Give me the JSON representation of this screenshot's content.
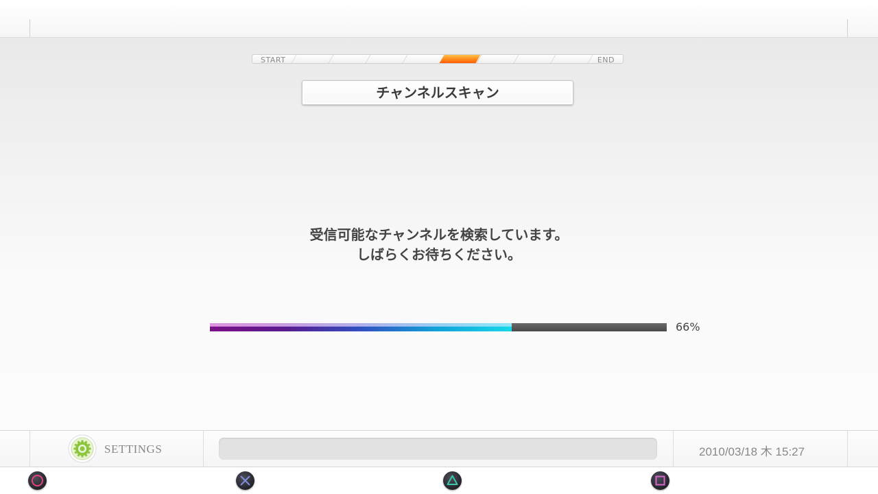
{
  "step_indicator": {
    "start_label": "START",
    "end_label": "END",
    "total_steps": 10,
    "current_step": 5
  },
  "dialog": {
    "title": "チャンネルスキャン",
    "message_line1": "受信可能なチャンネルを検索しています。",
    "message_line2": "しばらくお待ちください。"
  },
  "progress": {
    "value": 66,
    "label": "66%",
    "track_color": "#555555",
    "gradient_colors": [
      "#7a1185",
      "#3050c0",
      "#17d8ea"
    ]
  },
  "status_bar": {
    "app_label": "SETTINGS",
    "app_icon": "gear-icon",
    "info_text": "",
    "datetime": "2010/03/18 木 15:27"
  },
  "controller_buttons": [
    {
      "icon": "circle-button-icon",
      "color": "#e0437a"
    },
    {
      "icon": "cross-button-icon",
      "color": "#7d8fd6"
    },
    {
      "icon": "triangle-button-icon",
      "color": "#39c9a6"
    },
    {
      "icon": "square-button-icon",
      "color": "#d866c8"
    }
  ],
  "accent_color": "#ff7a1a"
}
